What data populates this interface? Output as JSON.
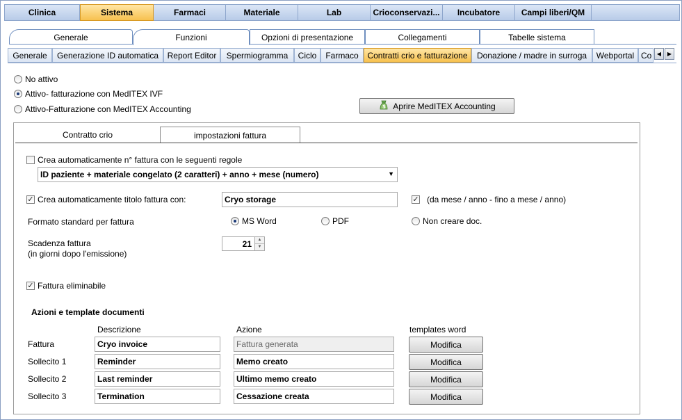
{
  "top_tabs": [
    "Clinica",
    "Sistema",
    "Farmaci",
    "Materiale",
    "Lab",
    "Crioconservazi...",
    "Incubatore",
    "Campi liberi/QM"
  ],
  "sub_tabs": [
    "Generale",
    "Funzioni",
    "Opzioni di presentazione",
    "Collegamenti",
    "Tabelle sistema"
  ],
  "function_tabs": [
    "Generale",
    "Generazione ID automatica",
    "Report Editor",
    "Spermiogramma",
    "Ciclo",
    "Farmaco",
    "Contratti crio e fatturazione",
    "Donazione / madre in surroga",
    "Webportal",
    "Co"
  ],
  "billing_mode": {
    "options": [
      "No attivo",
      "Attivo- fatturazione con MedITEX IVF",
      "Attivo-Fatturazione con MedITEX Accounting"
    ],
    "open_accounting_button": "Aprire MedITEX Accounting"
  },
  "panel_tabs": [
    "Contratto crio",
    "impostazioni fattura"
  ],
  "invoice": {
    "auto_number_label": "Crea automaticamente n° fattura con le seguenti regole",
    "auto_number_rule": "ID paziente + materiale congelato (2 caratteri) + anno + mese (numero)",
    "auto_title_label": "Crea automaticamente titolo fattura con:",
    "auto_title_value": "Cryo storage",
    "period_label": "(da mese / anno - fino a mese / anno)",
    "format_label": "Formato standard per fattura",
    "format_options": [
      "MS Word",
      "PDF",
      "Non creare doc."
    ],
    "due_label_1": "Scadenza fattura",
    "due_label_2": "(in giorni dopo l'emissione)",
    "due_value": "21",
    "deletable_label": "Fattura eliminabile"
  },
  "actions": {
    "title": "Azioni e template documenti",
    "headers": [
      "Descrizione",
      "Azione",
      "templates word"
    ],
    "rows": [
      {
        "label": "Fattura",
        "description": "Cryo invoice",
        "action": "Fattura generata",
        "button": "Modifica"
      },
      {
        "label": "Sollecito 1",
        "description": "Reminder",
        "action": "Memo creato",
        "button": "Modifica"
      },
      {
        "label": "Sollecito 2",
        "description": "Last reminder",
        "action": "Ultimo memo creato",
        "button": "Modifica"
      },
      {
        "label": "Sollecito 3",
        "description": "Termination",
        "action": "Cessazione creata",
        "button": "Modifica"
      }
    ]
  }
}
